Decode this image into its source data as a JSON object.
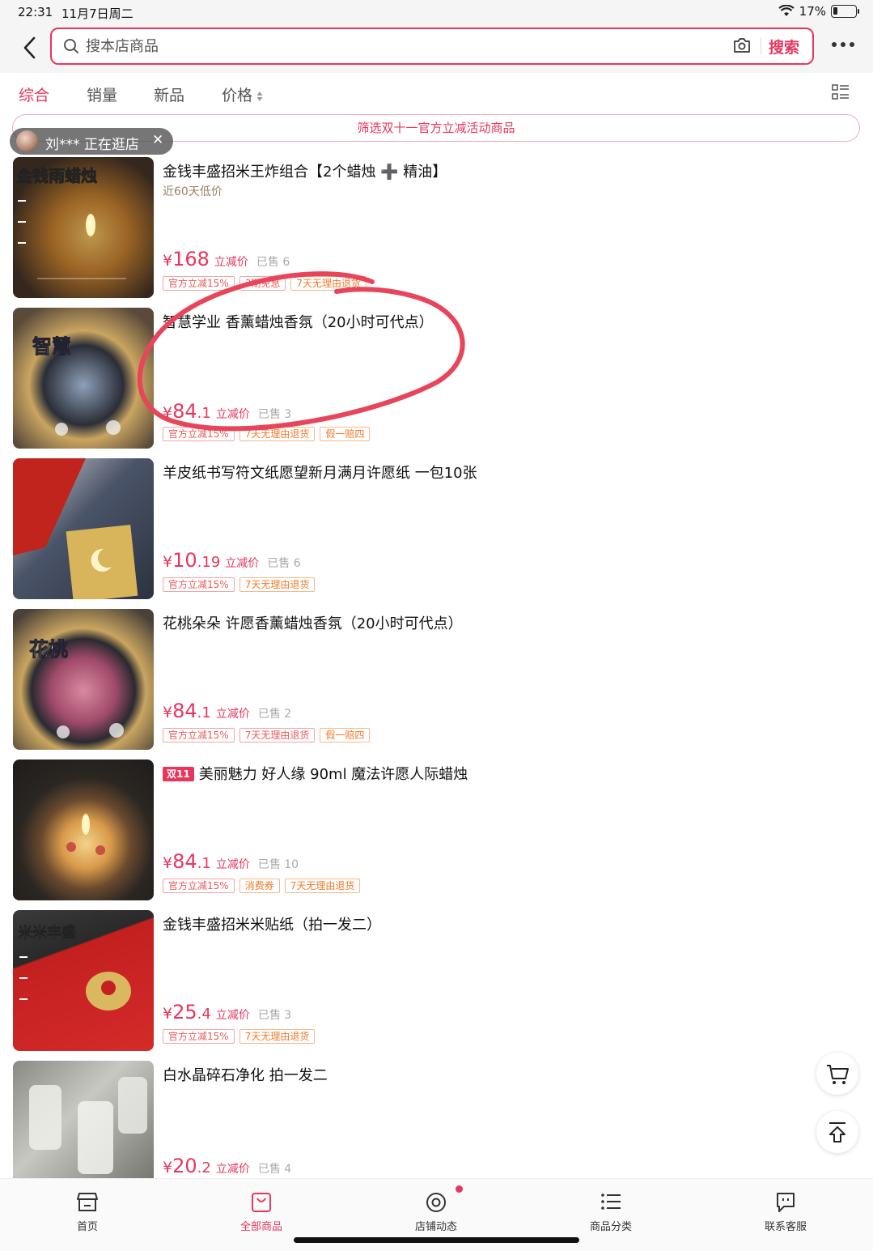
{
  "status": {
    "time": "22:31",
    "date": "11月7日周二",
    "battery": "17%"
  },
  "search": {
    "placeholder": "搜本店商品",
    "button": "搜索"
  },
  "tabs": [
    {
      "label": "综合",
      "active": true
    },
    {
      "label": "销量"
    },
    {
      "label": "新品"
    },
    {
      "label": "价格"
    }
  ],
  "filter_banner": "筛选双十一官方立减活动商品",
  "visitor": {
    "text": "刘*** 正在逛店",
    "close": "✕"
  },
  "products": [
    {
      "title": "金钱丰盛招米王炸组合【2个蜡烛 ➕ 精油】",
      "subtitle": "近60天低价",
      "price_int": "168",
      "price_dec": "",
      "price_label": "立减价",
      "sold": "已售 6",
      "tags": [
        "官方立减15%",
        "3期免息",
        "7天无理由退货"
      ],
      "thumb_text": "金钱雨蜡烛"
    },
    {
      "title": "智慧学业 香薰蜡烛香氛（20小时可代点）",
      "price_int": "84",
      "price_dec": ".1",
      "price_label": "立减价",
      "sold": "已售 3",
      "tags": [
        "官方立减15%",
        "7天无理由退货",
        "假一赔四"
      ],
      "thumb_text": "智慧"
    },
    {
      "title": "羊皮纸书写符文纸愿望新月满月许愿纸 一包10张",
      "price_int": "10",
      "price_dec": ".19",
      "price_label": "立减价",
      "sold": "已售 6",
      "tags": [
        "官方立减15%",
        "7天无理由退货"
      ]
    },
    {
      "title": "花桃朵朵 许愿香薰蜡烛香氛（20小时可代点）",
      "price_int": "84",
      "price_dec": ".1",
      "price_label": "立减价",
      "sold": "已售 2",
      "tags": [
        "官方立减15%",
        "7天无理由退货",
        "假一赔四"
      ],
      "thumb_text": "花桃"
    },
    {
      "title": "美丽魅力 好人缘  90ml 魔法许愿人际蜡烛",
      "badge": "双11",
      "price_int": "84",
      "price_dec": ".1",
      "price_label": "立减价",
      "sold": "已售 10",
      "tags": [
        "官方立减15%",
        "消费券",
        "7天无理由退货"
      ]
    },
    {
      "title": "金钱丰盛招米米贴纸（拍一发二）",
      "price_int": "25",
      "price_dec": ".4",
      "price_label": "立减价",
      "sold": "已售 3",
      "tags": [
        "官方立减15%",
        "7天无理由退货"
      ],
      "thumb_text": "米米丰盛"
    },
    {
      "title": "白水晶碎石净化 拍一发二",
      "price_int": "20",
      "price_dec": ".2",
      "price_label": "立减价",
      "sold": "已售 4",
      "tags": []
    }
  ],
  "bottom_nav": [
    {
      "label": "首页",
      "icon": "shop-icon"
    },
    {
      "label": "全部商品",
      "icon": "bag-icon",
      "active": true
    },
    {
      "label": "店铺动态",
      "icon": "activity-icon"
    },
    {
      "label": "商品分类",
      "icon": "list-icon"
    },
    {
      "label": "联系客服",
      "icon": "chat-icon"
    }
  ],
  "colors": {
    "accent": "#e8365d",
    "tag": "#e85a5a",
    "annotation": "#e8455a"
  }
}
